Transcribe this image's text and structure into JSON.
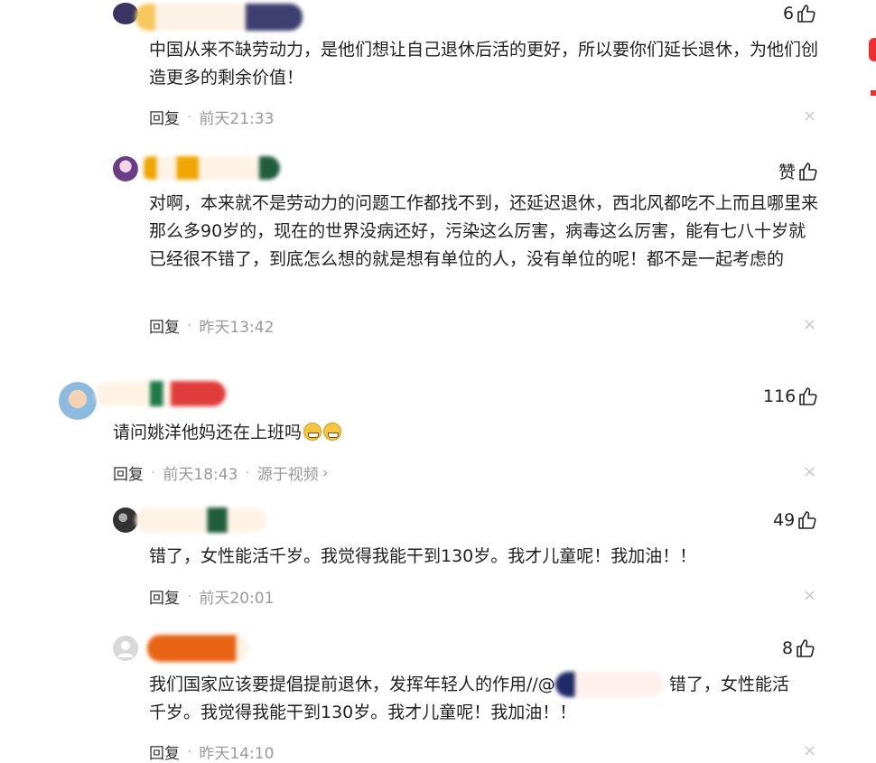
{
  "comments": [
    {
      "likes": "6",
      "text": "中国从来不缺劳动力，是他们想让自己退休后活的更好，所以要你们延长退休，为他们创造更多的剩余价值！",
      "reply": "回复",
      "time": "前天21:33"
    },
    {
      "likes": "赞",
      "text": "对啊，本来就不是劳动力的问题工作都找不到，还延迟退休，西北风都吃不上而且哪里来那么多90岁的，现在的世界没病还好，污染这么厉害，病毒这么厉害，能有七八十岁就已经很不错了，到底怎么想的就是想有单位的人，没有单位的呢！都不是一起考虑的",
      "reply": "回复",
      "time": "昨天13:42"
    },
    {
      "likes": "116",
      "text": "请问姚洋他妈还在上班吗",
      "reply": "回复",
      "time": "前天18:43",
      "source": "源于视频"
    },
    {
      "likes": "49",
      "text": "错了，女性能活千岁。我觉得我能干到130岁。我才儿童呢！我加油！！",
      "reply": "回复",
      "time": "前天20:01"
    },
    {
      "likes": "8",
      "text_part1": "我们国家应该要提倡提前退休，发挥年轻人的作用//@",
      "text_part2": "错了，女性能活",
      "text_line2": "千岁。我觉得我能干到130岁。我才儿童呢！我加油！！",
      "reply": "回复",
      "time": "昨天14:10"
    }
  ],
  "close_symbol": "×",
  "source_chevron": "›"
}
